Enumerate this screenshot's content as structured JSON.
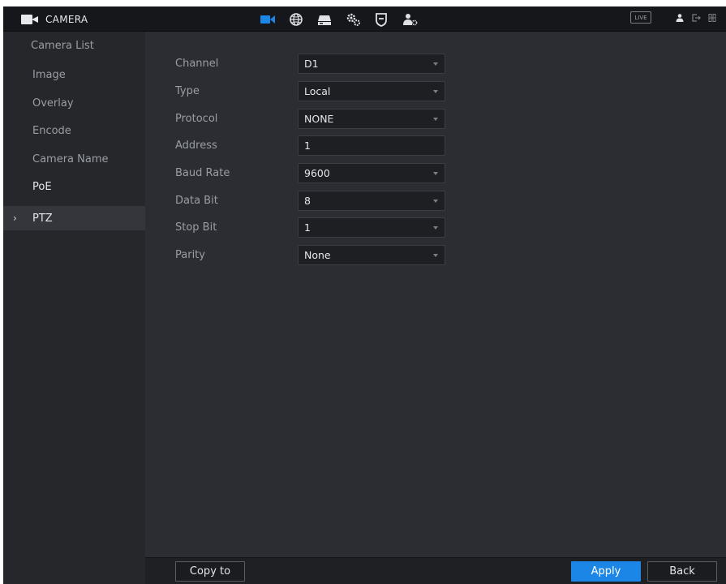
{
  "header": {
    "title": "CAMERA",
    "live_label": "LIVE",
    "nav_icons": [
      "camera-icon",
      "network-icon",
      "storage-icon",
      "system-icon",
      "security-icon",
      "account-icon"
    ],
    "active_color": "#1c86e6"
  },
  "sidebar": {
    "items": [
      {
        "label": "Camera List"
      },
      {
        "label": "Image"
      },
      {
        "label": "Overlay"
      },
      {
        "label": "Encode"
      },
      {
        "label": "Camera Name"
      },
      {
        "label": "PoE"
      },
      {
        "label": "PTZ",
        "active": true
      }
    ]
  },
  "form": {
    "channel": {
      "label": "Channel",
      "value": "D1"
    },
    "type": {
      "label": "Type",
      "value": "Local"
    },
    "protocol": {
      "label": "Protocol",
      "value": "NONE"
    },
    "address": {
      "label": "Address",
      "value": "1"
    },
    "baud_rate": {
      "label": "Baud Rate",
      "value": "9600"
    },
    "data_bit": {
      "label": "Data Bit",
      "value": "8"
    },
    "stop_bit": {
      "label": "Stop Bit",
      "value": "1"
    },
    "parity": {
      "label": "Parity",
      "value": "None"
    }
  },
  "footer": {
    "copy_label": "Copy to",
    "apply_label": "Apply",
    "back_label": "Back"
  }
}
